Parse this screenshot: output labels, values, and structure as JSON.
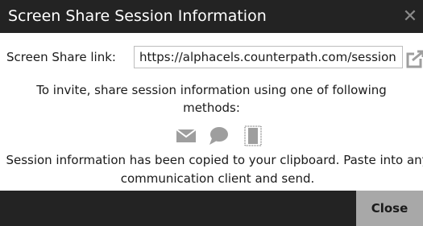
{
  "dialog": {
    "title": "Screen Share Session Information",
    "close_glyph": "✕"
  },
  "link": {
    "label": "Screen Share link:",
    "value": "https://alphacels.counterpath.com/session",
    "icon": "open-link-icon"
  },
  "invite": {
    "text": "To invite, share session information using one of following methods:"
  },
  "methods": [
    {
      "name": "email",
      "icon": "envelope-icon"
    },
    {
      "name": "chat",
      "icon": "chat-bubble-icon"
    },
    {
      "name": "clipboard",
      "icon": "copy-icon"
    }
  ],
  "status": {
    "copied_text": "Session information has been copied to your clipboard. Paste into any communication client and send."
  },
  "footer": {
    "close_label": "Close"
  },
  "colors": {
    "titlebar": "#232323",
    "footer": "#232323",
    "close_button": "#a8a8a8",
    "icon_gray": "#9e9e9e"
  }
}
